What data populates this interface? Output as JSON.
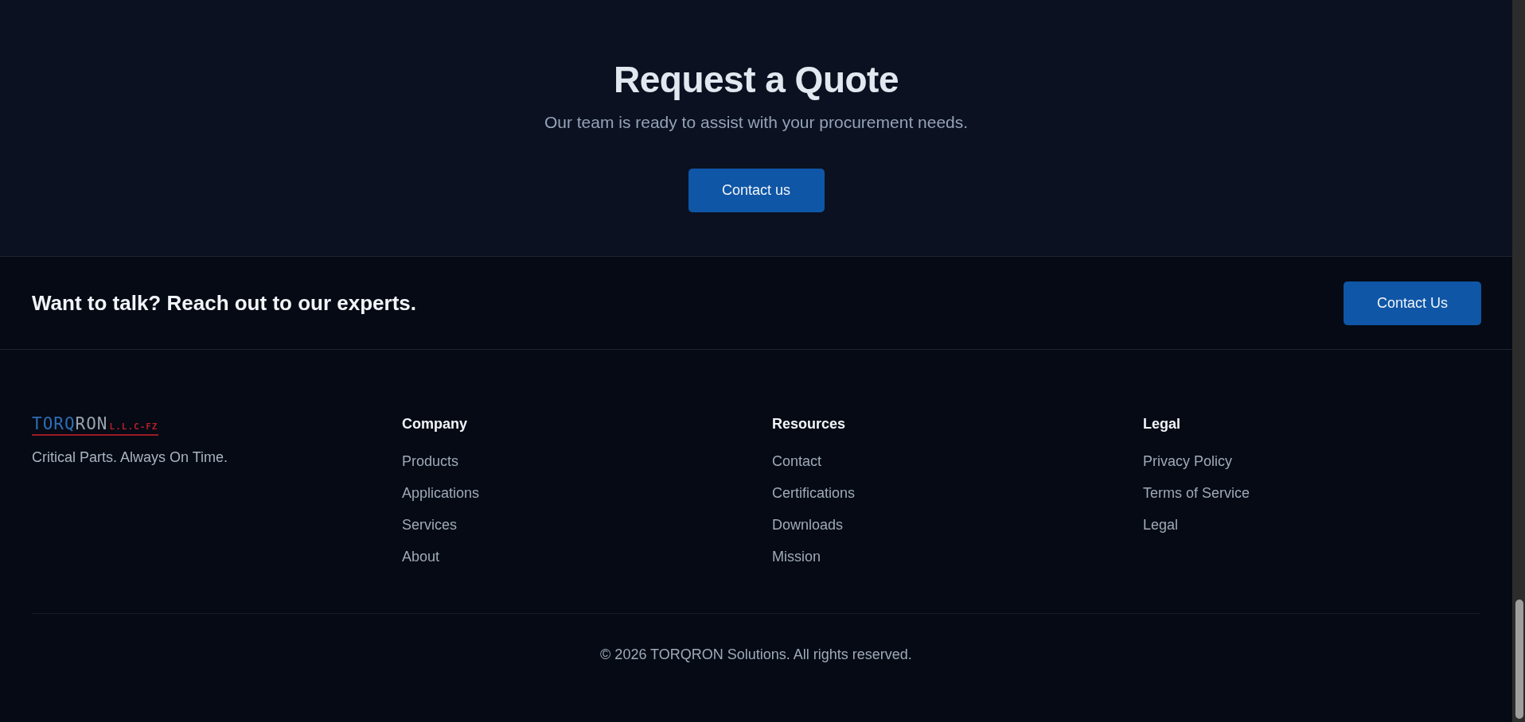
{
  "quote": {
    "title": "Request a Quote",
    "subtitle": "Our team is ready to assist with your procurement needs.",
    "button": "Contact us"
  },
  "cta": {
    "text": "Want to talk? Reach out to our experts.",
    "button": "Contact Us"
  },
  "footer": {
    "logo": {
      "primary": "TORQ",
      "secondary": "RON",
      "suffix": "L.L.C-FZ"
    },
    "tagline": "Critical Parts. Always On Time.",
    "columns": [
      {
        "heading": "Company",
        "links": [
          "Products",
          "Applications",
          "Services",
          "About"
        ]
      },
      {
        "heading": "Resources",
        "links": [
          "Contact",
          "Certifications",
          "Downloads",
          "Mission"
        ]
      },
      {
        "heading": "Legal",
        "links": [
          "Privacy Policy",
          "Terms of Service",
          "Legal"
        ]
      }
    ],
    "copyright": "© 2026 TORQRON Solutions. All rights reserved."
  }
}
